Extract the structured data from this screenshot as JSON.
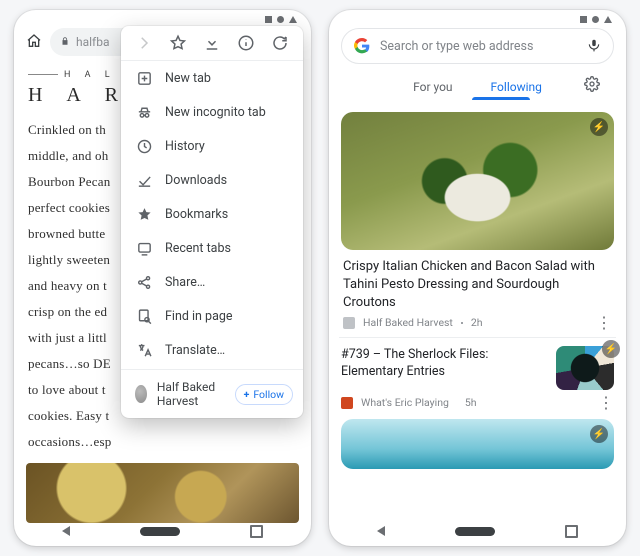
{
  "phone_a": {
    "url_fragment": "halfba",
    "site_eyebrow": "H A L F",
    "site_title": "H A R",
    "article_lines": [
      "Crinkled on th",
      "middle, and oh",
      "Bourbon Pecan",
      "perfect cookies",
      "browned butte",
      "lightly sweeten",
      "and heavy on t",
      "crisp on the ed",
      "with just a littl",
      "pecans…so DE",
      "to love about t",
      "cookies. Easy t",
      "occasions…esp"
    ]
  },
  "menu": {
    "items": [
      {
        "icon": "plus-box",
        "label": "New tab"
      },
      {
        "icon": "incognito",
        "label": "New incognito tab"
      },
      {
        "icon": "history",
        "label": "History"
      },
      {
        "icon": "download-check",
        "label": "Downloads"
      },
      {
        "icon": "star",
        "label": "Bookmarks"
      },
      {
        "icon": "recent",
        "label": "Recent tabs"
      },
      {
        "icon": "share",
        "label": "Share…"
      },
      {
        "icon": "find",
        "label": "Find in page"
      },
      {
        "icon": "translate",
        "label": "Translate…"
      }
    ],
    "follow_site": "Half Baked Harvest",
    "follow_btn": "Follow"
  },
  "phone_b": {
    "search_placeholder": "Search or type web address",
    "tabs": {
      "for_you": "For you",
      "following": "Following"
    },
    "feed": {
      "card1": {
        "title": "Crispy Italian Chicken and Bacon Salad with Tahini Pesto Dressing and Sourdough Croutons",
        "source": "Half Baked Harvest",
        "age": "2h"
      },
      "card2": {
        "title": "#739 – The Sherlock Files: Elementary Entries",
        "source": "What's Eric Playing",
        "age": "5h"
      }
    }
  }
}
